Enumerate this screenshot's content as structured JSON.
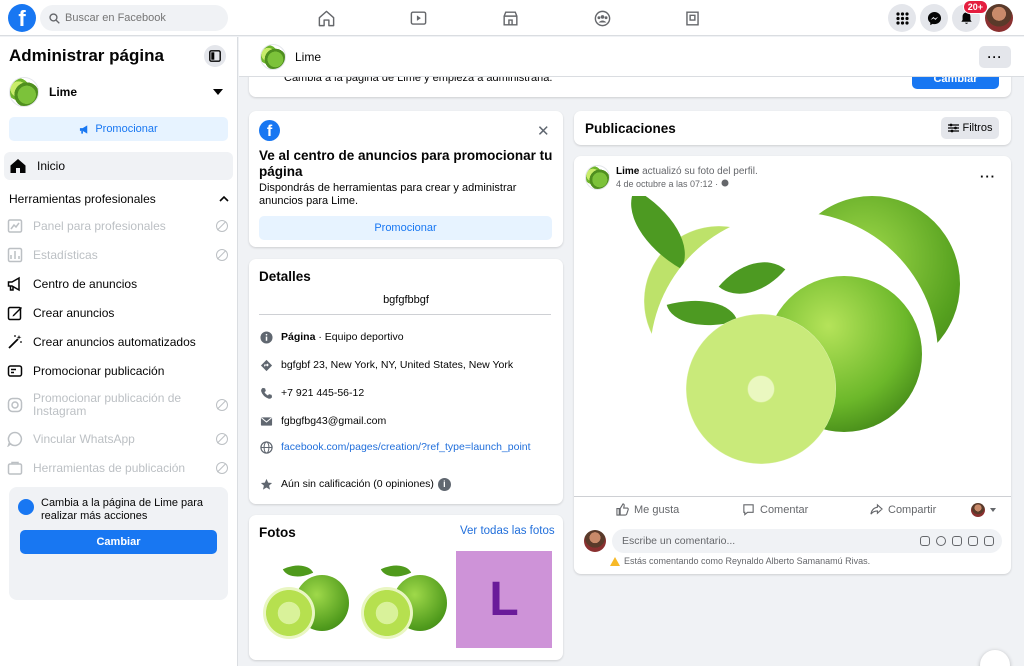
{
  "topbar": {
    "search_placeholder": "Buscar en Facebook",
    "notifications_badge": "20+",
    "nav_icons": [
      "home-icon",
      "watch-icon",
      "marketplace-icon",
      "groups-icon",
      "gaming-icon"
    ],
    "right_icons": [
      "menu-grid-icon",
      "messenger-icon",
      "notifications-icon"
    ]
  },
  "sidebar": {
    "title": "Administrar página",
    "page_name": "Lime",
    "promote_label": "Promocionar",
    "home_label": "Inicio",
    "section_label": "Herramientas profesionales",
    "items": [
      {
        "label": "Panel para profesionales",
        "disabled": true,
        "icon": "dashboard-icon"
      },
      {
        "label": "Estadísticas",
        "disabled": true,
        "icon": "insights-icon"
      },
      {
        "label": "Centro de anuncios",
        "disabled": false,
        "icon": "megaphone-icon"
      },
      {
        "label": "Crear anuncios",
        "disabled": false,
        "icon": "edit-icon"
      },
      {
        "label": "Crear anuncios automatizados",
        "disabled": false,
        "icon": "magic-wand-icon"
      },
      {
        "label": "Promocionar publicación",
        "disabled": false,
        "icon": "promote-post-icon"
      },
      {
        "label": "Promocionar publicación de Instagram",
        "disabled": true,
        "icon": "instagram-icon"
      },
      {
        "label": "Vincular WhatsApp",
        "disabled": true,
        "icon": "whatsapp-icon"
      },
      {
        "label": "Herramientas de publicación",
        "disabled": true,
        "icon": "publishing-tools-icon"
      }
    ],
    "switch_text": "Cambia a la página de Lime para realizar más acciones",
    "switch_button": "Cambiar"
  },
  "header": {
    "page_name": "Lime",
    "more_label": "···"
  },
  "switch_banner": {
    "text": "Cambia a la página de Lime y empieza a administrarla.",
    "button": "Cambiar"
  },
  "ads_card": {
    "title": "Ve al centro de anuncios para promocionar tu página",
    "description": "Dispondrás de herramientas para crear y administrar anuncios para Lime.",
    "button": "Promocionar",
    "close": "✕"
  },
  "details": {
    "title": "Detalles",
    "bio": "bgfgfbbgf",
    "category_prefix": "Página",
    "category": " · Equipo deportivo",
    "address": "bgfgbf 23, New York, NY, United States, New York",
    "phone": "+7 921 445-56-12",
    "email": "fgbgfbg43@gmail.com",
    "website": "facebook.com/pages/creation/?ref_type=launch_point",
    "rating": "Aún sin calificación (0 opiniones)"
  },
  "photos": {
    "title": "Fotos",
    "see_all": "Ver todas las fotos",
    "letter_tile": "L"
  },
  "posts": {
    "title": "Publicaciones",
    "filter_label": "Filtros"
  },
  "post": {
    "author": "Lime",
    "action": " actualizó su foto del perfil.",
    "date": "4 de octubre a las 07:12 · ",
    "more": "···",
    "like": "Me gusta",
    "comment": "Comentar",
    "share": "Compartir",
    "comment_placeholder": "Escribe un comentario...",
    "warning": "Estás comentando como Reynaldo Alberto Samanamú Rivas."
  },
  "colors": {
    "brand": "#1877f2",
    "background": "#f0f2f5",
    "link": "#216fdb",
    "disabled": "#bcc0c4",
    "letter_tile": "#ce93d8"
  }
}
